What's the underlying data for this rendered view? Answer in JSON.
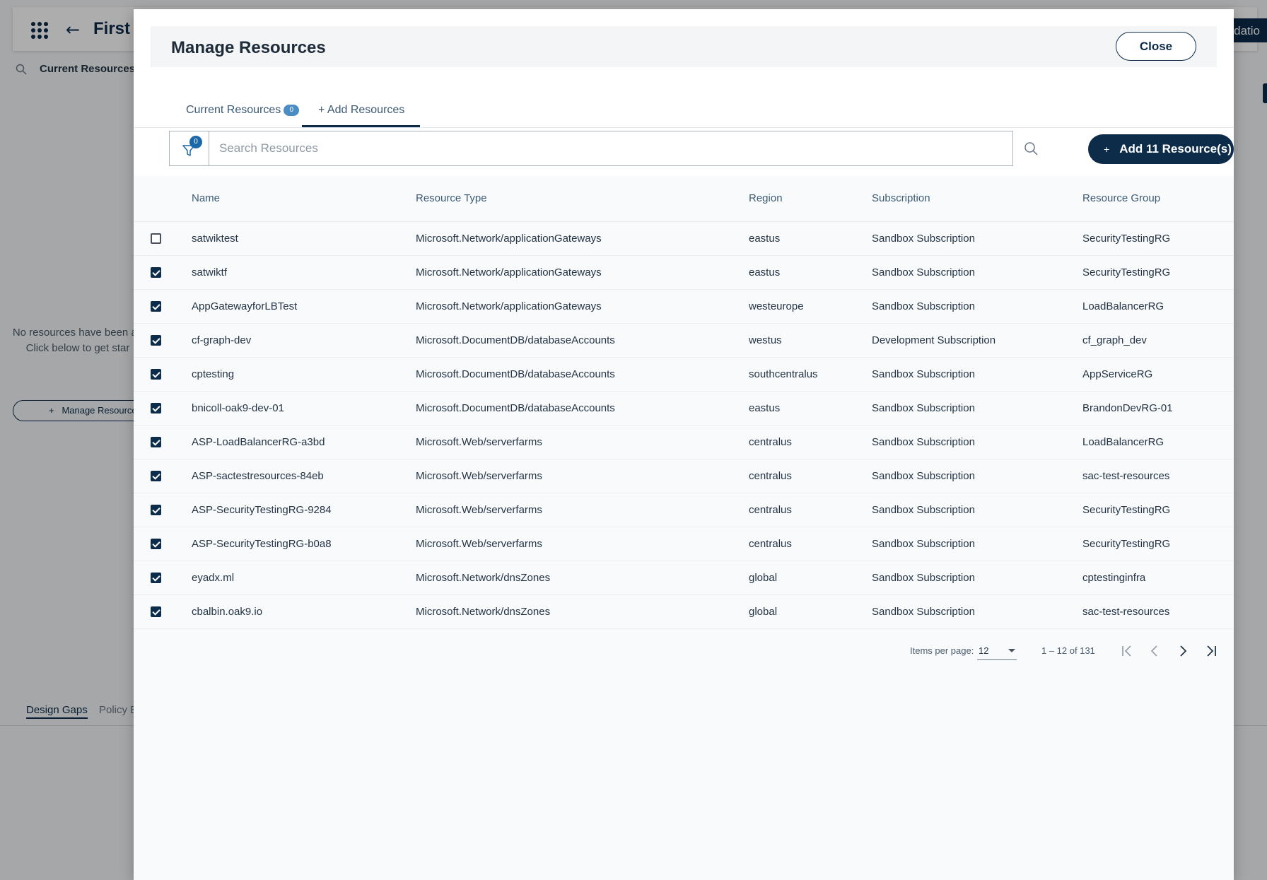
{
  "background": {
    "title": "First p",
    "validation_label": "alidatio",
    "current_resources_label": "Current Resources",
    "empty_line1": "No resources have been ad",
    "empty_line2": "Click below to get star",
    "manage_button": "Manage Resource",
    "tabs": [
      "Design Gaps",
      "Policy E"
    ]
  },
  "modal": {
    "title": "Manage Resources",
    "close_label": "Close",
    "tabs": {
      "current_label": "Current Resources",
      "current_count": "0",
      "add_label": "+ Add Resources"
    },
    "filter_count": "0",
    "search_placeholder": "Search Resources",
    "add_button_label": "Add 11 Resource(s)",
    "table": {
      "columns": [
        "Name",
        "Resource Type",
        "Region",
        "Subscription",
        "Resource Group"
      ],
      "rows": [
        {
          "checked": false,
          "name": "satwiktest",
          "type": "Microsoft.Network/applicationGateways",
          "region": "eastus",
          "subscription": "Sandbox Subscription",
          "group": "SecurityTestingRG"
        },
        {
          "checked": true,
          "name": "satwiktf",
          "type": "Microsoft.Network/applicationGateways",
          "region": "eastus",
          "subscription": "Sandbox Subscription",
          "group": "SecurityTestingRG"
        },
        {
          "checked": true,
          "name": "AppGatewayforLBTest",
          "type": "Microsoft.Network/applicationGateways",
          "region": "westeurope",
          "subscription": "Sandbox Subscription",
          "group": "LoadBalancerRG"
        },
        {
          "checked": true,
          "name": "cf-graph-dev",
          "type": "Microsoft.DocumentDB/databaseAccounts",
          "region": "westus",
          "subscription": "Development Subscription",
          "group": "cf_graph_dev"
        },
        {
          "checked": true,
          "name": "cptesting",
          "type": "Microsoft.DocumentDB/databaseAccounts",
          "region": "southcentralus",
          "subscription": "Sandbox Subscription",
          "group": "AppServiceRG"
        },
        {
          "checked": true,
          "name": "bnicoll-oak9-dev-01",
          "type": "Microsoft.DocumentDB/databaseAccounts",
          "region": "eastus",
          "subscription": "Sandbox Subscription",
          "group": "BrandonDevRG-01"
        },
        {
          "checked": true,
          "name": "ASP-LoadBalancerRG-a3bd",
          "type": "Microsoft.Web/serverfarms",
          "region": "centralus",
          "subscription": "Sandbox Subscription",
          "group": "LoadBalancerRG"
        },
        {
          "checked": true,
          "name": "ASP-sactestresources-84eb",
          "type": "Microsoft.Web/serverfarms",
          "region": "centralus",
          "subscription": "Sandbox Subscription",
          "group": "sac-test-resources"
        },
        {
          "checked": true,
          "name": "ASP-SecurityTestingRG-9284",
          "type": "Microsoft.Web/serverfarms",
          "region": "centralus",
          "subscription": "Sandbox Subscription",
          "group": "SecurityTestingRG"
        },
        {
          "checked": true,
          "name": "ASP-SecurityTestingRG-b0a8",
          "type": "Microsoft.Web/serverfarms",
          "region": "centralus",
          "subscription": "Sandbox Subscription",
          "group": "SecurityTestingRG"
        },
        {
          "checked": true,
          "name": "eyadx.ml",
          "type": "Microsoft.Network/dnsZones",
          "region": "global",
          "subscription": "Sandbox Subscription",
          "group": "cptestinginfra"
        },
        {
          "checked": true,
          "name": "cbalbin.oak9.io",
          "type": "Microsoft.Network/dnsZones",
          "region": "global",
          "subscription": "Sandbox Subscription",
          "group": "sac-test-resources"
        }
      ]
    },
    "pager": {
      "items_per_page_label": "Items per page:",
      "items_per_page": "12",
      "range": "1 – 12 of 131"
    }
  },
  "icons": {
    "app_grid": "app-grid-icon",
    "back": "arrow-left-icon",
    "search": "search-icon",
    "filter": "filter-icon",
    "plus": "plus-icon",
    "first_page": "first-page-icon",
    "prev_page": "chevron-left-icon",
    "next_page": "chevron-right-icon",
    "last_page": "last-page-icon"
  },
  "colors": {
    "primary": "#0d2c4a",
    "badge": "#4a8cc4",
    "overlay": "rgba(0,0,0,0.32)"
  }
}
